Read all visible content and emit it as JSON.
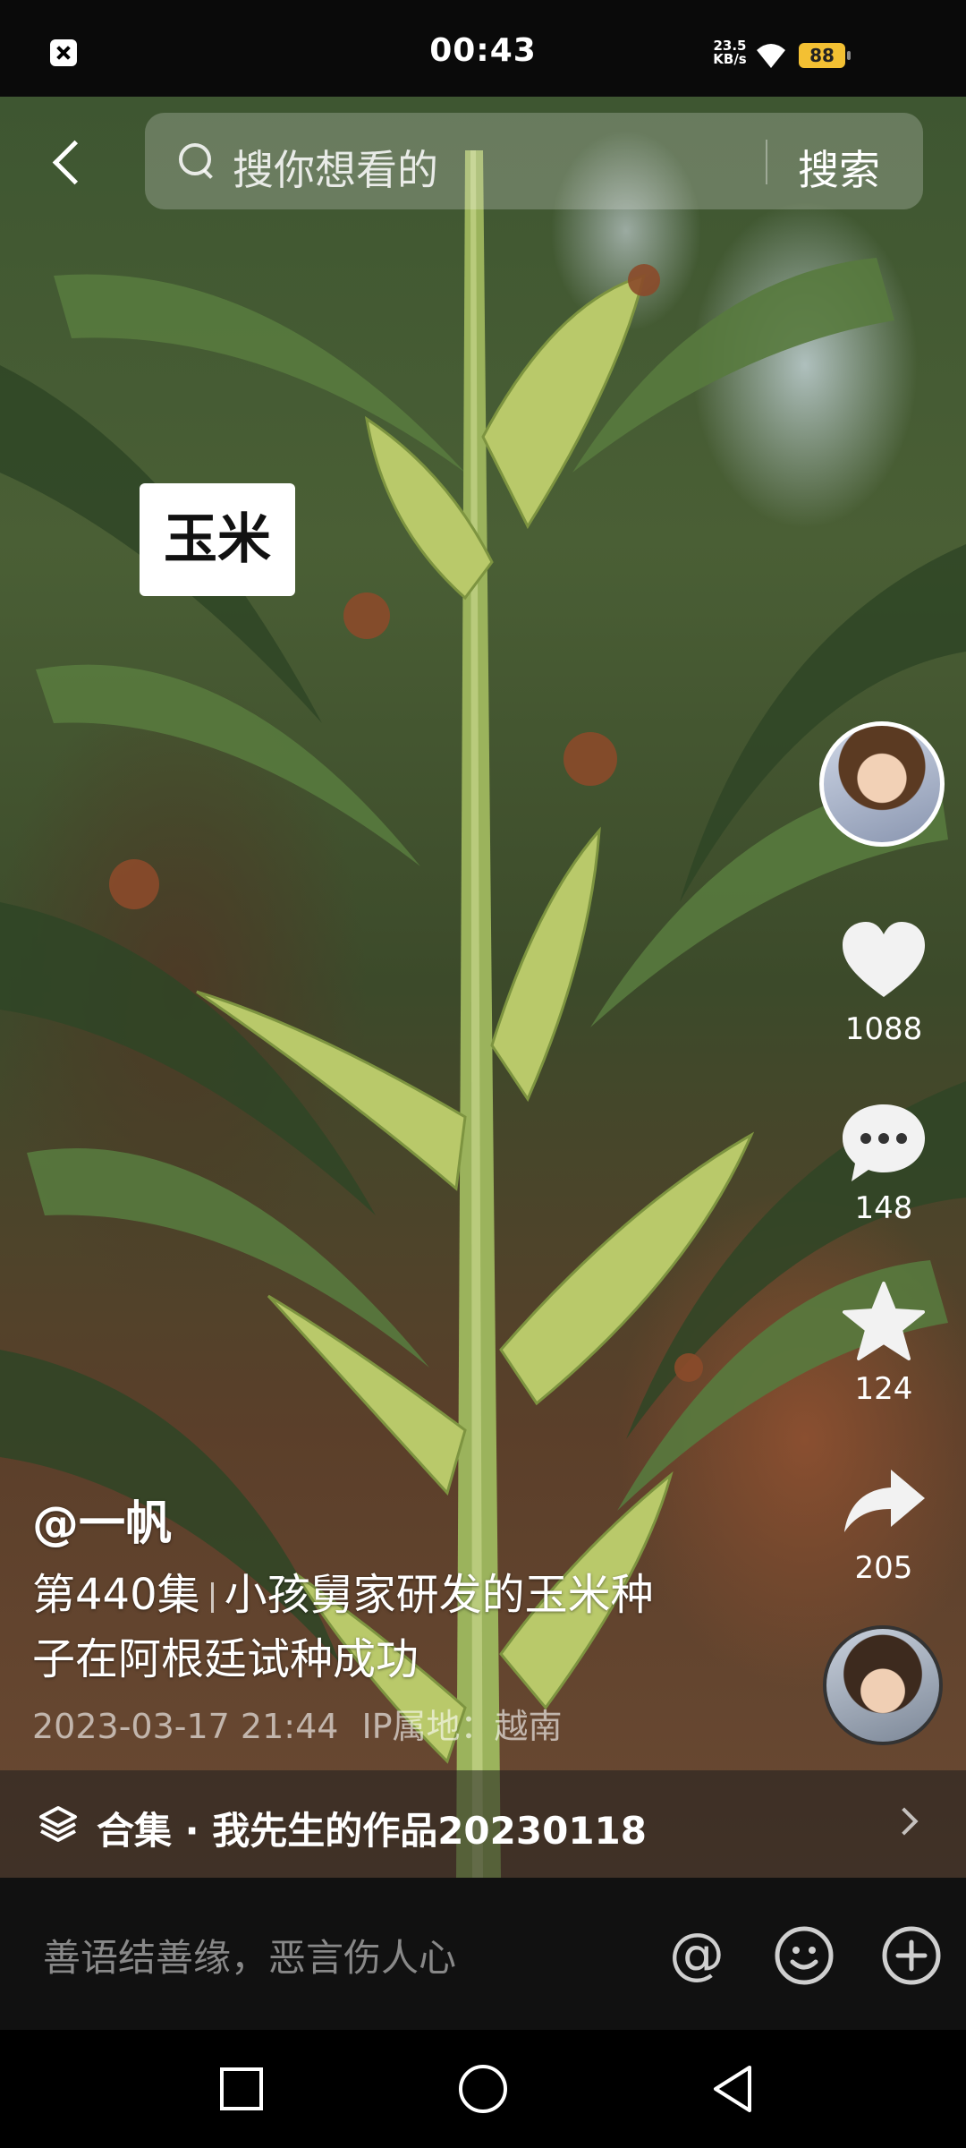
{
  "status_bar": {
    "time": "00:43",
    "net_speed_value": "23.5",
    "net_speed_unit": "KB/s",
    "battery": "88"
  },
  "search": {
    "placeholder": "搜你想看的",
    "button": "搜索"
  },
  "video": {
    "overlay_label": "玉米"
  },
  "actions": {
    "likes": "1088",
    "comments": "148",
    "favorites": "124",
    "shares": "205"
  },
  "caption": {
    "author": "@一帆",
    "episode": "第440集",
    "title_line1": "小孩舅家研发的玉米种",
    "title_line2": "子在阿根廷试种成功",
    "date": "2023-03-17 21:44",
    "location": "IP属地：越南"
  },
  "collection": {
    "text": "合集 · 我先生的作品20230118"
  },
  "comment_bar": {
    "placeholder": "善语结善缘，恶言伤人心"
  },
  "icons": {
    "like": "heart-icon",
    "comment": "speech-bubble-icon",
    "favorite": "star-icon",
    "share": "share-arrow-icon",
    "mention": "at-icon",
    "emoji": "emoji-icon",
    "add": "plus-circle-icon"
  },
  "colors": {
    "battery": "#f3c033",
    "background": "#000000"
  }
}
